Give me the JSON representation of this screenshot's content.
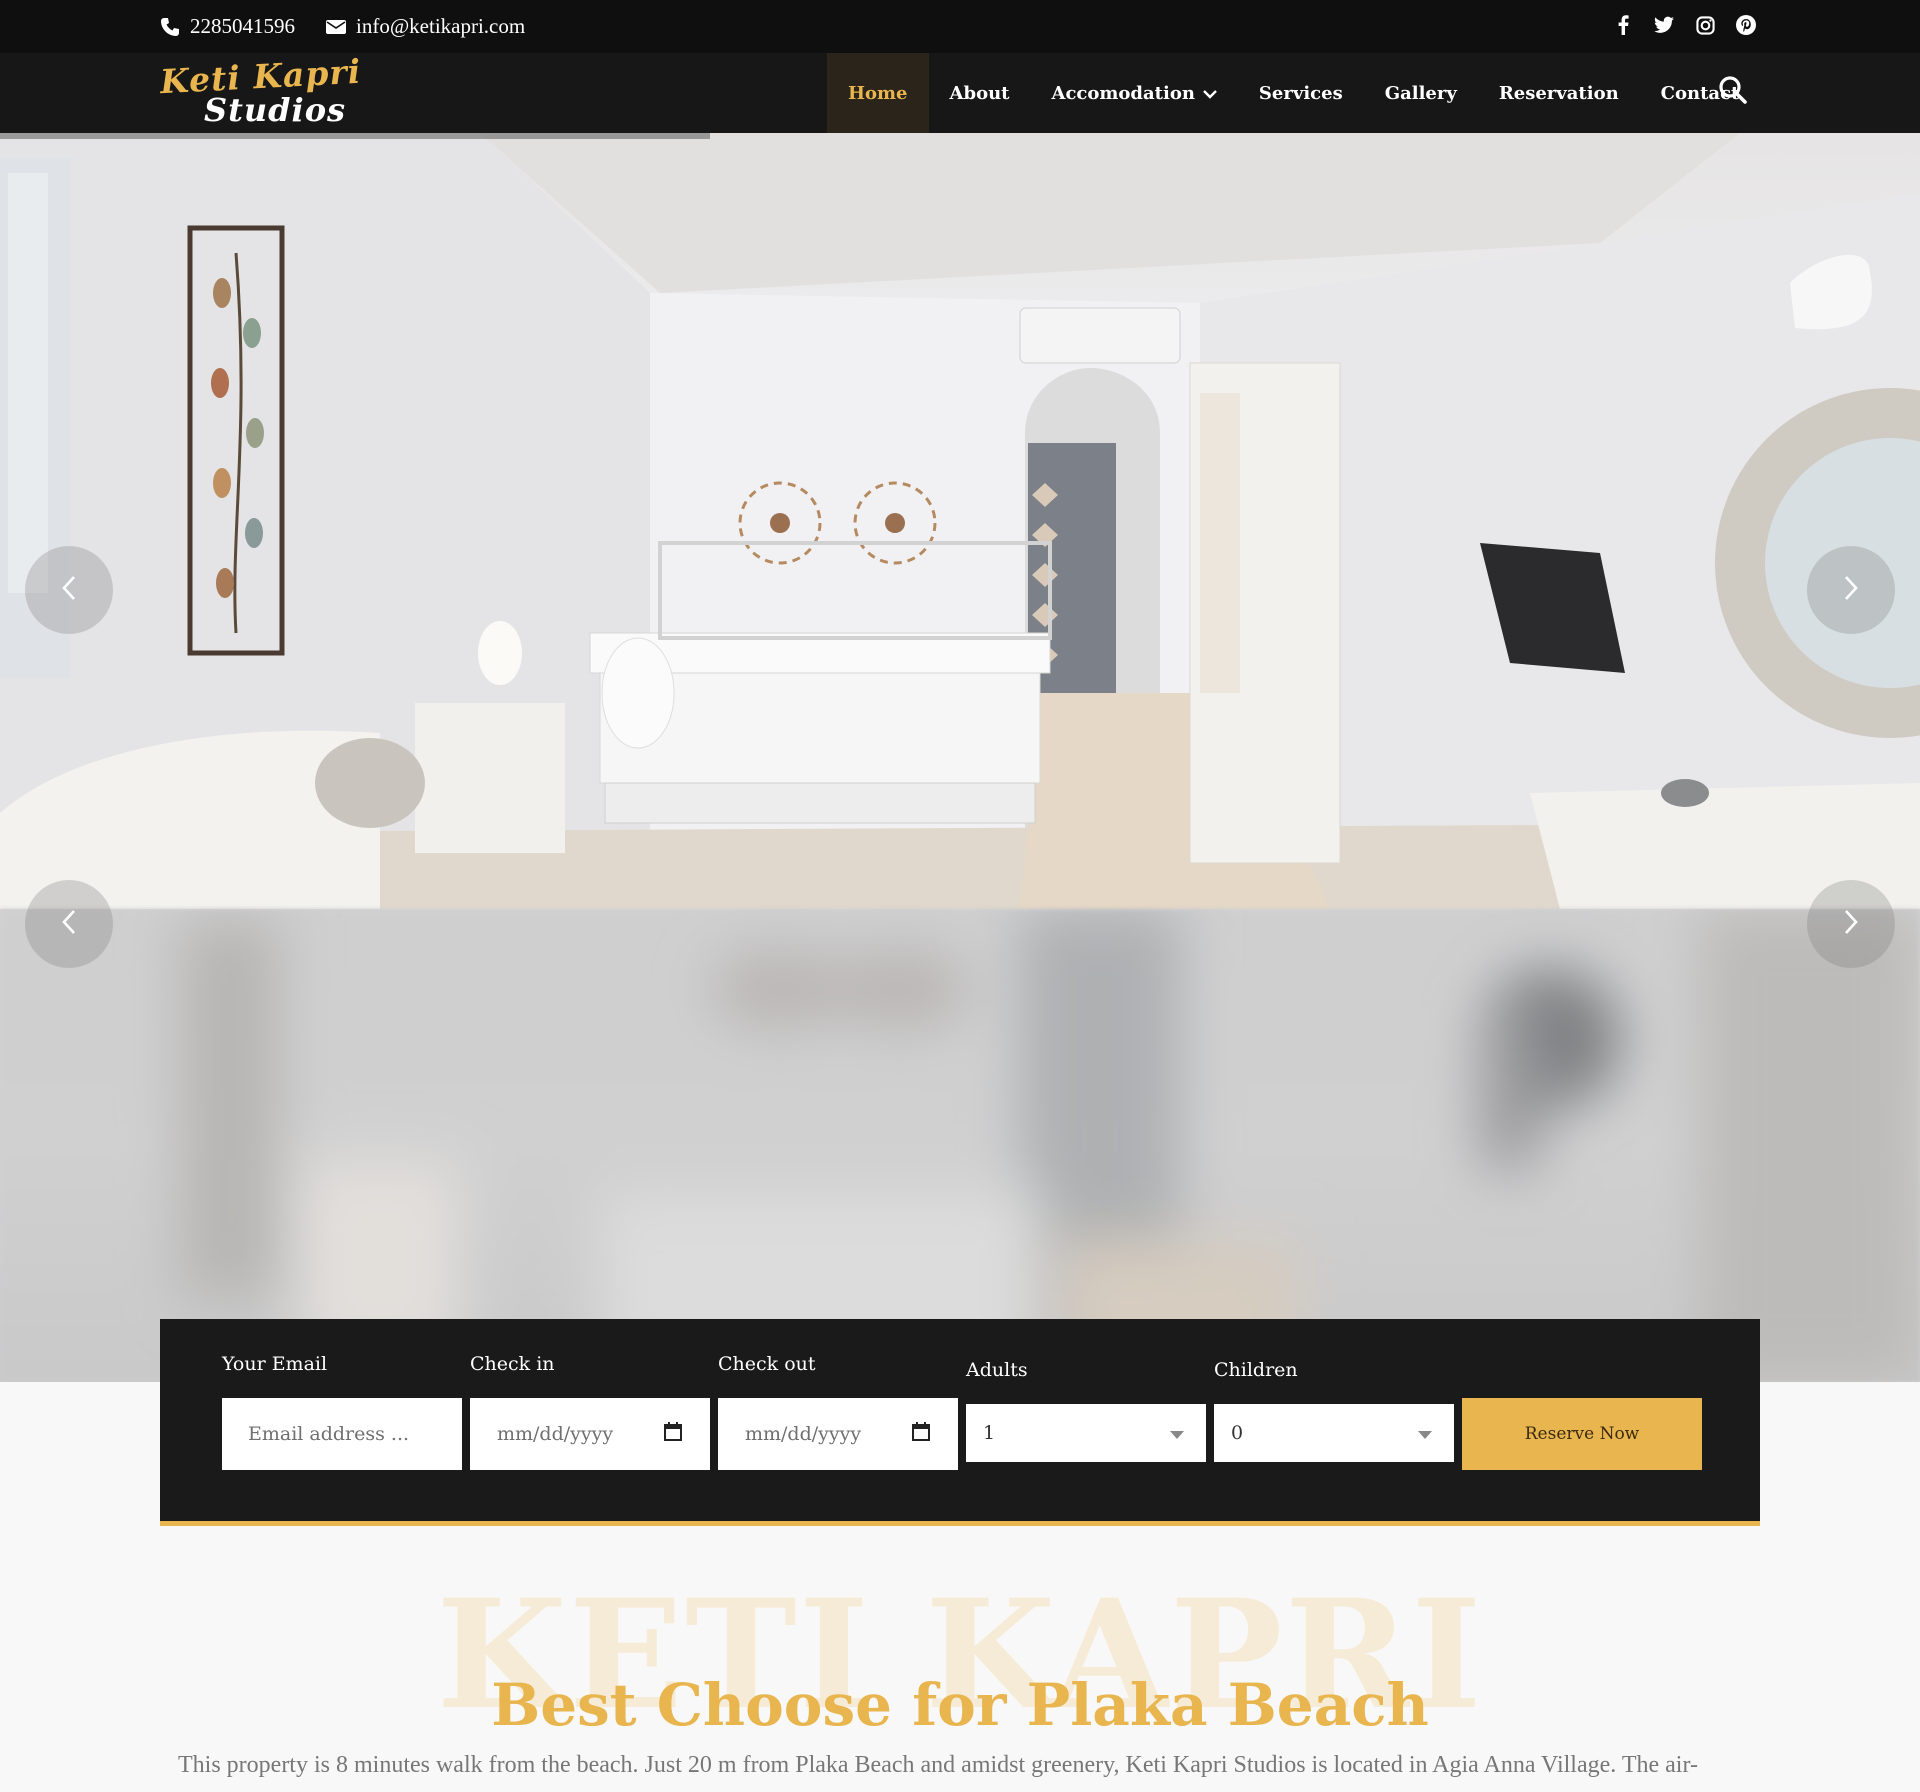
{
  "topbar": {
    "phone": "2285041596",
    "email": "info@ketikapri.com",
    "social": [
      "facebook-icon",
      "twitter-icon",
      "instagram-icon",
      "pinterest-icon"
    ]
  },
  "brand": {
    "line1": "Keti Kapri",
    "line2": "Studios"
  },
  "nav": {
    "home": "Home",
    "about": "About",
    "accomodation": "Accomodation",
    "services": "Services",
    "gallery": "Gallery",
    "reservation": "Reservation",
    "contact": "Contact"
  },
  "booking": {
    "email_label": "Your Email",
    "email_placeholder": "Email address ...",
    "checkin_label": "Check in",
    "checkin_value": "mm/dd/yyyy",
    "checkout_label": "Check out",
    "checkout_value": "mm/dd/yyyy",
    "adults_label": "Adults",
    "adults_value": "1",
    "children_label": "Children",
    "children_value": "0",
    "reserve_label": "Reserve Now"
  },
  "about": {
    "watermark": "KETI KAPRI",
    "heading": "Best Choose for Plaka Beach",
    "text": "This property is 8 minutes walk from the beach. Just 20 m from Plaka Beach and amidst greenery, Keti Kapri Studios is located in Agia Anna Village. The air-"
  },
  "colors": {
    "accent": "#e8b54e",
    "dark": "#171717",
    "topbar": "#0f0f0f"
  }
}
